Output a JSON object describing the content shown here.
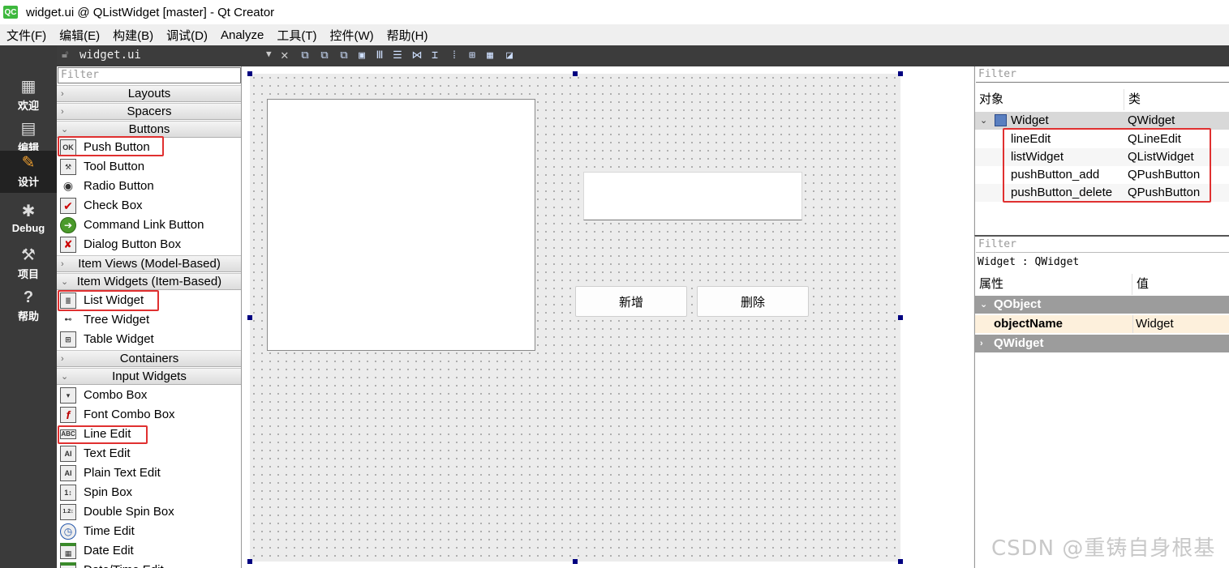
{
  "window": {
    "title": "widget.ui @ QListWidget [master] - Qt Creator",
    "app_icon": "QC"
  },
  "menu": [
    "文件(F)",
    "编辑(E)",
    "构建(B)",
    "调试(D)",
    "Analyze",
    "工具(T)",
    "控件(W)",
    "帮助(H)"
  ],
  "modes": [
    {
      "label": "欢迎",
      "icon": "grid-icon"
    },
    {
      "label": "编辑",
      "icon": "document-icon"
    },
    {
      "label": "设计",
      "icon": "pencil-icon",
      "active": true
    },
    {
      "label": "Debug",
      "icon": "bug-icon"
    },
    {
      "label": "项目",
      "icon": "wrench-icon"
    },
    {
      "label": "帮助",
      "icon": "help-icon"
    }
  ],
  "editor_toolbar": {
    "file_name": "widget.ui"
  },
  "widget_box": {
    "filter_placeholder": "Filter",
    "categories": {
      "layouts": "Layouts",
      "spacers": "Spacers",
      "buttons": "Buttons",
      "item_views": "Item Views (Model-Based)",
      "item_widgets": "Item Widgets (Item-Based)",
      "containers": "Containers",
      "input_widgets": "Input Widgets"
    },
    "buttons": [
      "Push Button",
      "Tool Button",
      "Radio Button",
      "Check Box",
      "Command Link Button",
      "Dialog Button Box"
    ],
    "item_widgets": [
      "List Widget",
      "Tree Widget",
      "Table Widget"
    ],
    "input_widgets": [
      "Combo Box",
      "Font Combo Box",
      "Line Edit",
      "Text Edit",
      "Plain Text Edit",
      "Spin Box",
      "Double Spin Box",
      "Time Edit",
      "Date Edit",
      "Date/Time Edit"
    ]
  },
  "form": {
    "button_add": "新增",
    "button_delete": "删除"
  },
  "object_inspector": {
    "filter_placeholder": "Filter",
    "col_object": "对象",
    "col_class": "类",
    "root": {
      "name": "Widget",
      "class": "QWidget"
    },
    "children": [
      {
        "name": "lineEdit",
        "class": "QLineEdit"
      },
      {
        "name": "listWidget",
        "class": "QListWidget"
      },
      {
        "name": "pushButton_add",
        "class": "QPushButton"
      },
      {
        "name": "pushButton_delete",
        "class": "QPushButton"
      }
    ]
  },
  "property_editor": {
    "filter_placeholder": "Filter",
    "subtitle": "Widget : QWidget",
    "col_property": "属性",
    "col_value": "值",
    "group_qobject": "QObject",
    "prop_name": "objectName",
    "prop_value": "Widget",
    "group_qwidget": "QWidget"
  },
  "watermark": "CSDN @重铸自身根基",
  "colors": {
    "highlight": "#e03030",
    "mode_bar": "#3a3a3a",
    "group_header": "#9c9c9c",
    "selected_row": "#fdf0dc"
  }
}
